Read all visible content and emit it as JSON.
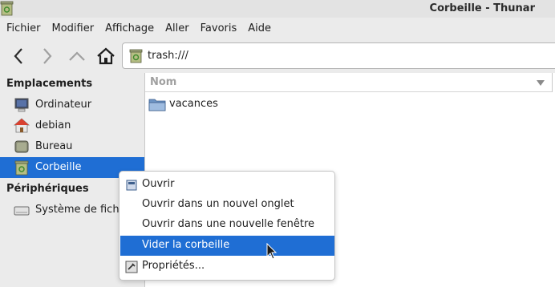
{
  "window": {
    "title": "Corbeille - Thunar",
    "app_icon": "trash-icon"
  },
  "menubar": {
    "items": [
      "Fichier",
      "Modifier",
      "Affichage",
      "Aller",
      "Favoris",
      "Aide"
    ]
  },
  "toolbar": {
    "back_icon": "back-arrow-icon",
    "forward_icon": "forward-arrow-icon",
    "up_icon": "up-arrow-icon",
    "home_icon": "home-icon",
    "location": {
      "icon": "trash-icon",
      "value": "trash:///"
    }
  },
  "sidebar": {
    "places_heading": "Emplacements",
    "places": [
      {
        "label": "Ordinateur",
        "icon": "computer-icon"
      },
      {
        "label": "debian",
        "icon": "home-folder-icon"
      },
      {
        "label": "Bureau",
        "icon": "desktop-icon"
      },
      {
        "label": "Corbeille",
        "icon": "trash-icon",
        "selected": true
      }
    ],
    "devices_heading": "Périphériques",
    "devices": [
      {
        "label": "Système de fichiers",
        "icon": "drive-icon"
      }
    ]
  },
  "fileview": {
    "column_name": "Nom",
    "files": [
      {
        "name": "vacances",
        "icon": "folder-icon"
      }
    ]
  },
  "context_menu": {
    "items": [
      {
        "label": "Ouvrir",
        "icon": "open-icon"
      },
      {
        "label": "Ouvrir dans un nouvel onglet"
      },
      {
        "label": "Ouvrir dans une nouvelle fenêtre"
      },
      {
        "label": "Vider la corbeille",
        "highlighted": true
      },
      {
        "label": "Propriétés...",
        "icon": "properties-icon"
      }
    ]
  },
  "colors": {
    "selection": "#1f6ed4",
    "window_bg": "#ebebeb"
  }
}
